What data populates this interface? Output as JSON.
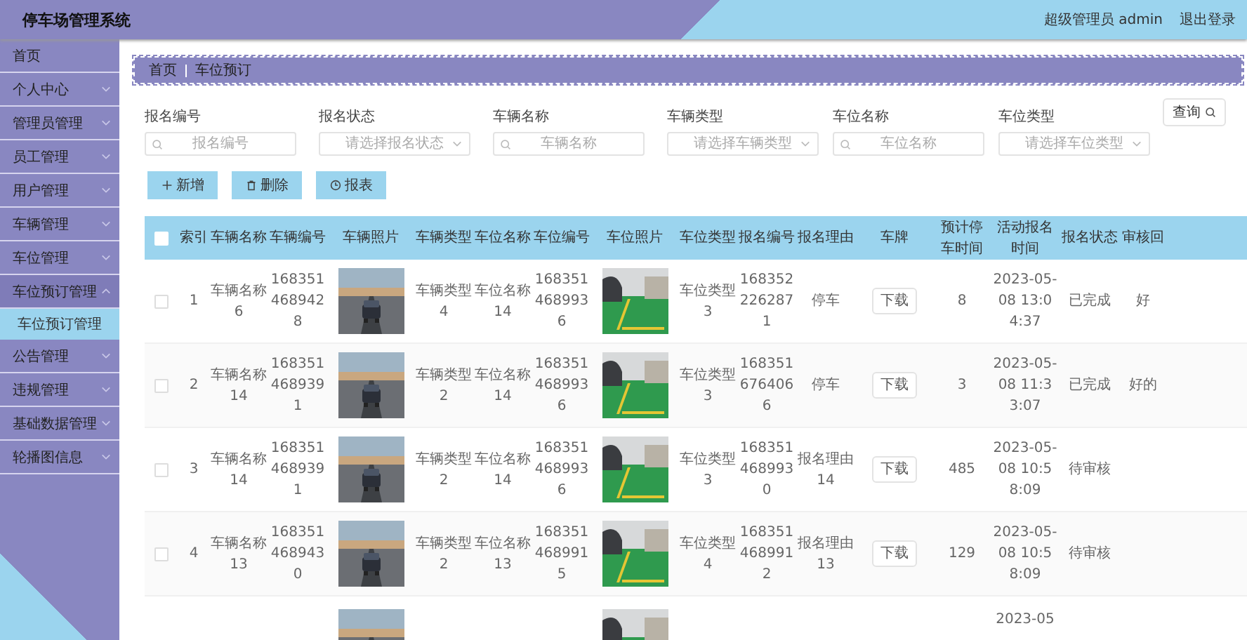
{
  "header": {
    "title": "停车场管理系统",
    "user": "超级管理员 admin",
    "logout": "退出登录"
  },
  "sidebar": {
    "items": [
      {
        "label": "首页",
        "kind": "link"
      },
      {
        "label": "个人中心",
        "kind": "menu"
      },
      {
        "label": "管理员管理",
        "kind": "menu"
      },
      {
        "label": "员工管理",
        "kind": "menu"
      },
      {
        "label": "用户管理",
        "kind": "menu"
      },
      {
        "label": "车辆管理",
        "kind": "menu"
      },
      {
        "label": "车位管理",
        "kind": "menu"
      },
      {
        "label": "车位预订管理",
        "kind": "menu",
        "expanded": true,
        "children": [
          {
            "label": "车位预订管理",
            "selected": true
          }
        ]
      },
      {
        "label": "公告管理",
        "kind": "menu"
      },
      {
        "label": "违规管理",
        "kind": "menu"
      },
      {
        "label": "基础数据管理",
        "kind": "menu"
      },
      {
        "label": "轮播图信息",
        "kind": "menu"
      }
    ]
  },
  "breadcrumb": [
    "首页",
    "车位预订"
  ],
  "filters": [
    {
      "label": "报名编号",
      "kind": "search",
      "placeholder": "报名编号"
    },
    {
      "label": "报名状态",
      "kind": "select",
      "placeholder": "请选择报名状态"
    },
    {
      "label": "车辆名称",
      "kind": "search",
      "placeholder": "车辆名称"
    },
    {
      "label": "车辆类型",
      "kind": "select",
      "placeholder": "请选择车辆类型"
    },
    {
      "label": "车位名称",
      "kind": "search",
      "placeholder": "车位名称"
    },
    {
      "label": "车位类型",
      "kind": "select",
      "placeholder": "请选择车位类型"
    }
  ],
  "query_button": "查询",
  "actions": [
    {
      "label": "新增",
      "kind": "add"
    },
    {
      "label": "删除",
      "kind": "delete"
    },
    {
      "label": "报表",
      "kind": "report"
    }
  ],
  "table": {
    "select_all_checked": false,
    "columns": [
      "索引",
      "车辆名称",
      "车辆编号",
      "车辆照片",
      "车辆类型",
      "车位名称",
      "车位编号",
      "车位照片",
      "车位类型",
      "报名编号",
      "报名理由",
      "车牌",
      "预计停车时间",
      "活动报名时间",
      "报名状态",
      "审核回"
    ],
    "rows": [
      {
        "checked": false,
        "index": "1",
        "car_name": "车辆名称6",
        "car_no": "1683514689428",
        "car_type": "车辆类型4",
        "spot_name": "车位名称14",
        "spot_no": "1683514689936",
        "spot_type": "车位类型3",
        "signup_no": "1683522262871",
        "reason": "停车",
        "plate": "下载",
        "hours": "8",
        "time": "2023-05-08 13:04:37",
        "status": "已完成",
        "reply": "好"
      },
      {
        "checked": false,
        "index": "2",
        "car_name": "车辆名称14",
        "car_no": "1683514689391",
        "car_type": "车辆类型2",
        "spot_name": "车位名称14",
        "spot_no": "1683514689936",
        "spot_type": "车位类型3",
        "signup_no": "1683516764066",
        "reason": "停车",
        "plate": "下载",
        "hours": "3",
        "time": "2023-05-08 11:33:07",
        "status": "已完成",
        "reply": "好的"
      },
      {
        "checked": false,
        "index": "3",
        "car_name": "车辆名称14",
        "car_no": "1683514689391",
        "car_type": "车辆类型2",
        "spot_name": "车位名称14",
        "spot_no": "1683514689936",
        "spot_type": "车位类型3",
        "signup_no": "1683514689930",
        "reason": "报名理由14",
        "plate": "下载",
        "hours": "485",
        "time": "2023-05-08 10:58:09",
        "status": "待审核"
      },
      {
        "checked": false,
        "index": "4",
        "car_name": "车辆名称13",
        "car_no": "1683514689430",
        "car_type": "车辆类型2",
        "spot_name": "车位名称13",
        "spot_no": "1683514689915",
        "spot_type": "车位类型4",
        "signup_no": "1683514689912",
        "reason": "报名理由13",
        "plate": "下载",
        "hours": "129",
        "time": "2023-05-08 10:58:09",
        "status": "待审核"
      },
      {
        "time": "2023-05"
      }
    ]
  }
}
